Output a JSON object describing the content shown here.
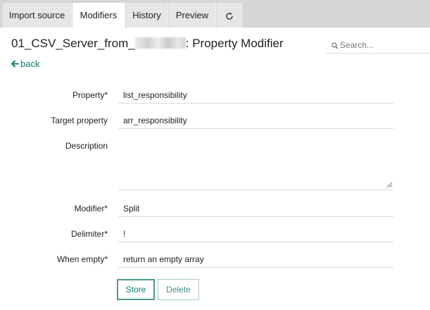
{
  "tabs": [
    {
      "label": "Import source"
    },
    {
      "label": "Modifiers"
    },
    {
      "label": "History"
    },
    {
      "label": "Preview"
    }
  ],
  "header": {
    "title_prefix": "01_CSV_Server_from_",
    "title_suffix": ": Property Modifier"
  },
  "search": {
    "placeholder": "Search..."
  },
  "back": {
    "label": "back"
  },
  "form": {
    "property_label": "Property*",
    "property_value": "list_responsibility",
    "target_label": "Target property",
    "target_value": "arr_responsibility",
    "description_label": "Description",
    "description_value": "",
    "modifier_label": "Modifier*",
    "modifier_value": "Split",
    "delimiter_label": "Delimiter*",
    "delimiter_value": "!",
    "when_empty_label": "When empty*",
    "when_empty_value": "return an empty array"
  },
  "buttons": {
    "store": "Store",
    "delete": "Delete"
  },
  "colors": {
    "accent": "#0b7f75",
    "tabbar": "#d6d6d6"
  }
}
